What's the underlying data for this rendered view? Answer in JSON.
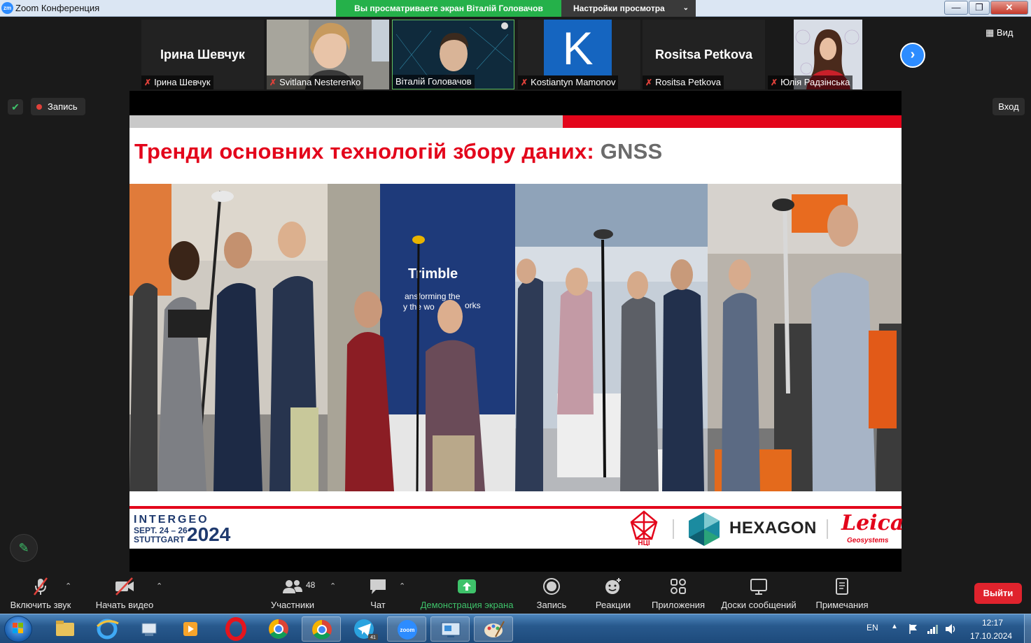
{
  "window": {
    "app_logo": "zm",
    "title": "Zoom Конференция",
    "share_banner": "Вы просматриваете экран Віталій Головачов",
    "view_settings": "Настройки просмотра"
  },
  "top_right": {
    "view_label": "Вид"
  },
  "participants": [
    {
      "display": "Ірина Шевчук",
      "label": "Ірина Шевчук",
      "muted": true,
      "type": "name"
    },
    {
      "display": "",
      "label": "Svitlana Nesterenko",
      "muted": true,
      "type": "photo"
    },
    {
      "display": "",
      "label": "Віталій Головачов",
      "muted": false,
      "type": "photo",
      "active": true
    },
    {
      "display": "K",
      "label": "Kostiantyn Mamonov",
      "muted": true,
      "type": "letter"
    },
    {
      "display": "Rositsa Petkova",
      "label": "Rositsa Petkova",
      "muted": true,
      "type": "name"
    },
    {
      "display": "",
      "label": "Юлія Радзінська",
      "muted": true,
      "type": "photo"
    }
  ],
  "status": {
    "recording_label": "Запись",
    "enter_label": "Вход"
  },
  "slide": {
    "heading": "Тренди основних технологій збору даних:",
    "heading_highlight": "GNSS",
    "photo_text": "Trimble",
    "photo_subtext": "ansforming the",
    "photo_subtext2": "y the wo",
    "photo_subtext3": "orks",
    "intergeo_top": "INTERGEO",
    "intergeo_date_1": "SEPT. 24 – 26",
    "intergeo_date_2": "STUTTGART",
    "intergeo_year": "2024",
    "ntu_label": "НЦІ",
    "hexagon": "HEXAGON",
    "leica": "Leica",
    "leica_sub": "Geosystems"
  },
  "toolbar": {
    "unmute": "Включить звук",
    "start_video": "Начать видео",
    "participants": "Участники",
    "participants_count": "48",
    "chat": "Чат",
    "share_screen": "Демонстрация экрана",
    "record": "Запись",
    "reactions": "Реакции",
    "apps": "Приложения",
    "whiteboards": "Доски сообщений",
    "notes": "Примечания",
    "leave": "Выйти"
  },
  "taskbar": {
    "lang": "EN",
    "time": "12:17",
    "date": "17.10.2024",
    "telegram_badge": "41"
  },
  "colors": {
    "zoom_blue": "#2d8cff",
    "share_green": "#25b14a",
    "leave_red": "#e0232d",
    "slide_red": "#e3051b"
  }
}
